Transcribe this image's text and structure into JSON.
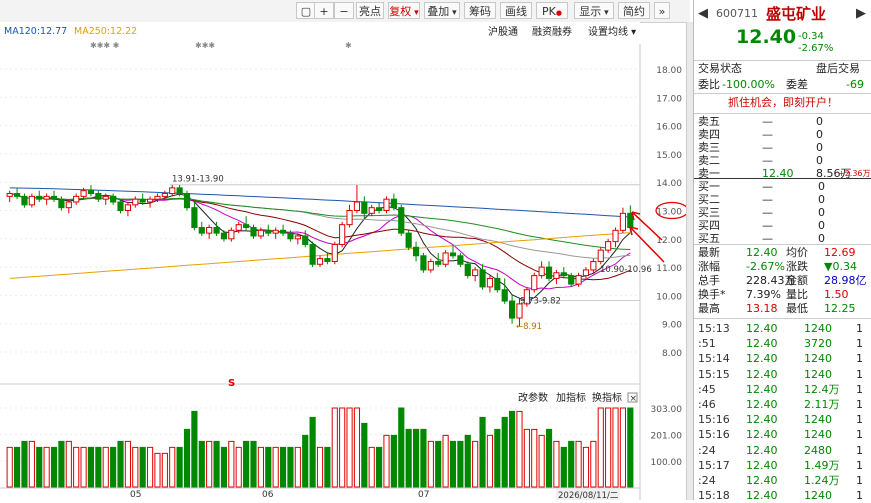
{
  "toolbar": {
    "buttons": [
      "+",
      "−",
      "亮点",
      "复权",
      "叠加",
      "筹码",
      "画线",
      "PK",
      "显示",
      "简约"
    ],
    "pk_badge": "●"
  },
  "chart": {
    "ma_labels": [
      {
        "text": "MA120:12.77",
        "color": "#1a56b0"
      },
      {
        "text": "MA250:12.22",
        "color": "#e6a100"
      }
    ],
    "menu": [
      "沪股通",
      "融资融券",
      "设置均线"
    ],
    "stars": [
      "✱✱✱ ✱",
      "✱✱✱",
      "✱"
    ],
    "price_ticks": [
      "18.00",
      "17.00",
      "16.00",
      "15.00",
      "14.00",
      "13.00",
      "12.00",
      "11.00",
      "10.00",
      "9.00",
      "8.00"
    ],
    "vol_ticks": [
      "303.00",
      "201.00",
      "100.00"
    ],
    "vol_menu": [
      "改参数",
      "加指标",
      "换指标"
    ],
    "month_labels": [
      "05",
      "06",
      "07"
    ],
    "date_label": "2026/08/11/二",
    "annotations": [
      "13.91-13.90",
      "9.73-9.82",
      "8.91",
      "10.90-10.96"
    ],
    "s_marker": "S",
    "current_price_label": "13.00"
  },
  "quote": {
    "code": "600711",
    "name": "盛屯矿业",
    "price": "12.40",
    "change": "-0.34",
    "pct": "-2.67%",
    "status_left": "交易状态",
    "status_right": "盘后交易",
    "weibi_label": "委比",
    "weibi": "-100.00%",
    "weicha_label": "委差",
    "weicha": "-69",
    "ad": "抓住机会，即刻开户！",
    "sell": [
      {
        "label": "卖五",
        "price": "—",
        "vol": "0"
      },
      {
        "label": "卖四",
        "price": "—",
        "vol": "0"
      },
      {
        "label": "卖三",
        "price": "—",
        "vol": "0"
      },
      {
        "label": "卖二",
        "price": "—",
        "vol": "0"
      },
      {
        "label": "卖一",
        "price": "12.40",
        "vol": "8.56万",
        "extra": "+2.36万"
      }
    ],
    "buy": [
      {
        "label": "买一",
        "price": "—",
        "vol": "0"
      },
      {
        "label": "买二",
        "price": "—",
        "vol": "0"
      },
      {
        "label": "买三",
        "price": "—",
        "vol": "0"
      },
      {
        "label": "买四",
        "price": "—",
        "vol": "0"
      },
      {
        "label": "买五",
        "price": "—",
        "vol": "0"
      }
    ],
    "stats": [
      {
        "l1": "最新",
        "v1": "12.40",
        "c1": "green",
        "l2": "均价",
        "v2": "12.69",
        "c2": "red"
      },
      {
        "l1": "涨幅",
        "v1": "-2.67%",
        "c1": "green",
        "l2": "涨跌",
        "v2": "▼0.34",
        "c2": "green"
      },
      {
        "l1": "总手",
        "v1": "228.43万",
        "c1": "black",
        "l2": "金额",
        "v2": "28.98亿",
        "c2": "blue"
      },
      {
        "l1": "换手*",
        "v1": "7.39%",
        "c1": "black",
        "l2": "量比",
        "v2": "1.50",
        "c2": "red"
      },
      {
        "l1": "最高",
        "v1": "13.18",
        "c1": "red",
        "l2": "最低",
        "v2": "12.25",
        "c2": "green"
      }
    ],
    "ticks": [
      {
        "t": "15:13",
        "p": "12.40",
        "v": "1240",
        "n": "1"
      },
      {
        "t": ":51",
        "p": "12.40",
        "v": "3720",
        "n": "1"
      },
      {
        "t": "15:14",
        "p": "12.40",
        "v": "1240",
        "n": "1"
      },
      {
        "t": "15:15",
        "p": "12.40",
        "v": "1240",
        "n": "1"
      },
      {
        "t": ":45",
        "p": "12.40",
        "v": "12.4万",
        "n": "1"
      },
      {
        "t": ":46",
        "p": "12.40",
        "v": "2.11万",
        "n": "1"
      },
      {
        "t": "15:16",
        "p": "12.40",
        "v": "1240",
        "n": "1"
      },
      {
        "t": "15:16",
        "p": "12.40",
        "v": "1240",
        "n": "1"
      },
      {
        "t": ":24",
        "p": "12.40",
        "v": "2480",
        "n": "1"
      },
      {
        "t": "15:17",
        "p": "12.40",
        "v": "1.49万",
        "n": "1"
      },
      {
        "t": ":24",
        "p": "12.40",
        "v": "1.24万",
        "n": "1"
      },
      {
        "t": "15:18",
        "p": "12.40",
        "v": "1240",
        "n": "1"
      }
    ]
  },
  "chart_data": {
    "type": "candlestick",
    "ylim": [
      8.0,
      18.0
    ],
    "ma_values": {
      "MA120": 12.77,
      "MA250": 12.22
    },
    "candles": [
      [
        13.5,
        13.7,
        13.3,
        13.6
      ],
      [
        13.6,
        13.8,
        13.4,
        13.5
      ],
      [
        13.5,
        13.6,
        13.1,
        13.2
      ],
      [
        13.2,
        13.6,
        13.1,
        13.5
      ],
      [
        13.5,
        13.7,
        13.3,
        13.4
      ],
      [
        13.4,
        13.6,
        13.2,
        13.5
      ],
      [
        13.5,
        13.7,
        13.3,
        13.4
      ],
      [
        13.4,
        13.5,
        13.0,
        13.1
      ],
      [
        13.1,
        13.4,
        12.9,
        13.3
      ],
      [
        13.3,
        13.6,
        13.2,
        13.5
      ],
      [
        13.5,
        13.8,
        13.4,
        13.7
      ],
      [
        13.7,
        13.9,
        13.5,
        13.6
      ],
      [
        13.6,
        13.7,
        13.3,
        13.4
      ],
      [
        13.4,
        13.6,
        13.2,
        13.5
      ],
      [
        13.5,
        13.6,
        13.2,
        13.3
      ],
      [
        13.3,
        13.4,
        12.9,
        13.0
      ],
      [
        13.0,
        13.3,
        12.8,
        13.2
      ],
      [
        13.2,
        13.5,
        13.1,
        13.4
      ],
      [
        13.4,
        13.6,
        13.2,
        13.3
      ],
      [
        13.3,
        13.5,
        13.1,
        13.4
      ],
      [
        13.4,
        13.6,
        13.3,
        13.5
      ],
      [
        13.5,
        13.7,
        13.4,
        13.6
      ],
      [
        13.6,
        13.9,
        13.5,
        13.8
      ],
      [
        13.8,
        13.9,
        13.5,
        13.6
      ],
      [
        13.6,
        13.7,
        13.0,
        13.1
      ],
      [
        13.1,
        13.3,
        12.3,
        12.4
      ],
      [
        12.4,
        12.6,
        12.1,
        12.2
      ],
      [
        12.2,
        12.5,
        12.0,
        12.4
      ],
      [
        12.4,
        12.6,
        12.1,
        12.2
      ],
      [
        12.2,
        12.3,
        11.9,
        12.0
      ],
      [
        12.0,
        12.4,
        11.9,
        12.3
      ],
      [
        12.3,
        12.6,
        12.2,
        12.5
      ],
      [
        12.5,
        12.8,
        12.3,
        12.4
      ],
      [
        12.4,
        12.5,
        12.0,
        12.1
      ],
      [
        12.1,
        12.4,
        12.0,
        12.3
      ],
      [
        12.3,
        12.5,
        12.1,
        12.2
      ],
      [
        12.2,
        12.4,
        12.0,
        12.3
      ],
      [
        12.3,
        12.5,
        12.1,
        12.2
      ],
      [
        12.2,
        12.3,
        11.9,
        12.0
      ],
      [
        12.0,
        12.2,
        11.8,
        12.1
      ],
      [
        12.1,
        12.3,
        11.7,
        11.8
      ],
      [
        11.8,
        11.9,
        11.0,
        11.1
      ],
      [
        11.1,
        11.4,
        11.0,
        11.3
      ],
      [
        11.3,
        11.5,
        11.1,
        11.2
      ],
      [
        11.2,
        11.9,
        11.1,
        11.8
      ],
      [
        11.8,
        12.6,
        11.7,
        12.5
      ],
      [
        12.5,
        13.2,
        12.4,
        13.0
      ],
      [
        13.0,
        13.9,
        12.9,
        13.3
      ],
      [
        13.3,
        13.5,
        12.7,
        12.9
      ],
      [
        12.9,
        13.2,
        12.8,
        13.1
      ],
      [
        13.1,
        13.3,
        12.9,
        13.0
      ],
      [
        13.0,
        13.5,
        12.9,
        13.4
      ],
      [
        13.4,
        13.6,
        13.0,
        13.1
      ],
      [
        13.1,
        13.2,
        12.1,
        12.2
      ],
      [
        12.2,
        12.3,
        11.6,
        11.7
      ],
      [
        11.7,
        11.9,
        11.2,
        11.4
      ],
      [
        11.4,
        11.5,
        10.8,
        10.9
      ],
      [
        10.9,
        11.3,
        10.8,
        11.2
      ],
      [
        11.2,
        11.5,
        11.0,
        11.1
      ],
      [
        11.1,
        11.6,
        11.0,
        11.5
      ],
      [
        11.5,
        11.8,
        11.3,
        11.4
      ],
      [
        11.4,
        11.5,
        11.0,
        11.1
      ],
      [
        11.1,
        11.2,
        10.6,
        10.7
      ],
      [
        10.7,
        11.0,
        10.5,
        10.9
      ],
      [
        10.9,
        11.1,
        10.2,
        10.3
      ],
      [
        10.3,
        10.7,
        10.1,
        10.6
      ],
      [
        10.6,
        10.8,
        10.1,
        10.2
      ],
      [
        10.2,
        10.6,
        9.7,
        9.8
      ],
      [
        9.8,
        10.0,
        9.0,
        9.2
      ],
      [
        9.2,
        9.9,
        8.9,
        9.7
      ],
      [
        9.7,
        10.3,
        9.6,
        10.2
      ],
      [
        10.2,
        10.8,
        10.1,
        10.7
      ],
      [
        10.7,
        11.2,
        10.6,
        11.0
      ],
      [
        11.0,
        11.2,
        10.5,
        10.6
      ],
      [
        10.6,
        10.9,
        10.4,
        10.8
      ],
      [
        10.8,
        11.0,
        10.6,
        10.7
      ],
      [
        10.7,
        10.8,
        10.3,
        10.4
      ],
      [
        10.4,
        10.8,
        10.3,
        10.7
      ],
      [
        10.7,
        11.0,
        10.6,
        10.9
      ],
      [
        10.9,
        11.3,
        10.8,
        11.2
      ],
      [
        11.2,
        11.7,
        11.1,
        11.6
      ],
      [
        11.6,
        12.0,
        11.5,
        11.9
      ],
      [
        11.9,
        12.4,
        11.7,
        12.3
      ],
      [
        12.3,
        13.1,
        12.2,
        12.9
      ],
      [
        12.9,
        13.18,
        12.25,
        12.4
      ]
    ]
  }
}
